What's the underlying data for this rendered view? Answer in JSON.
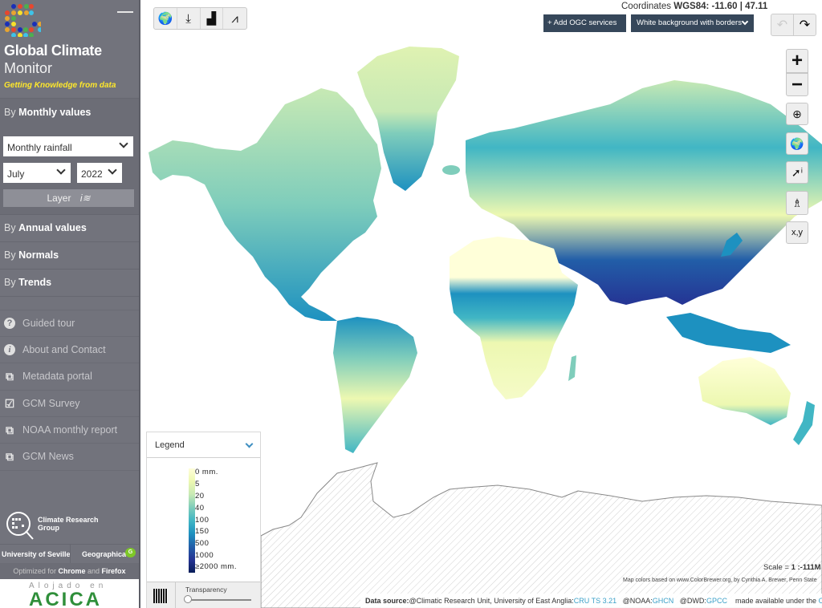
{
  "sidebar": {
    "brand": {
      "title": "Global Climate",
      "subtitle": "Monitor",
      "tagline": "Getting Knowledge from data"
    },
    "monthly": {
      "prefix": "By",
      "label": "Monthly values",
      "variable": "Monthly rainfall",
      "month": "July",
      "year": "2022",
      "layer_button": "Layer"
    },
    "sections": [
      {
        "prefix": "By",
        "label": "Annual values"
      },
      {
        "prefix": "By",
        "label": "Normals"
      },
      {
        "prefix": "By",
        "label": "Trends"
      }
    ],
    "links": [
      {
        "icon": "question-circle-icon",
        "glyph": "?",
        "label": "Guided tour"
      },
      {
        "icon": "info-circle-icon",
        "glyph": "i",
        "label": "About and Contact"
      },
      {
        "icon": "external-link-icon",
        "glyph": "⧉",
        "label": "Metadata portal"
      },
      {
        "icon": "checklist-icon",
        "glyph": "☑",
        "label": "GCM Survey"
      },
      {
        "icon": "external-link-icon",
        "glyph": "⧉",
        "label": "NOAA monthly report"
      },
      {
        "icon": "external-link-icon",
        "glyph": "⧉",
        "label": "GCM News"
      }
    ],
    "crg": {
      "line1": "Climate Research",
      "line2": "Group"
    },
    "university": "University of Seville",
    "geographica": "Geographica",
    "geographica_badge": "G",
    "optimized": {
      "prefix": "Optimized for",
      "b1": "Chrome",
      "and": "and",
      "b2": "Firefox"
    },
    "hosted": {
      "top": "Alojado en",
      "name": "ACICA"
    }
  },
  "toolbar": {
    "tools": [
      {
        "icon": "globe-icon",
        "glyph": "🌍"
      },
      {
        "icon": "download-icon",
        "glyph": "⤓"
      },
      {
        "icon": "bar-chart-icon",
        "glyph": "▟"
      },
      {
        "icon": "time-series-icon",
        "glyph": "⩘"
      }
    ]
  },
  "coordinates": {
    "label": "Coordinates",
    "system": "WGS84:",
    "lon": "-11.60",
    "lat": "47.11"
  },
  "ogc_button": "+ Add OGC services",
  "basemap": {
    "selected": "White background with borders"
  },
  "history": {
    "undo": "↶",
    "redo": "↷"
  },
  "map_controls": [
    {
      "name": "zoom-in-button",
      "glyph": "+"
    },
    {
      "name": "zoom-out-button",
      "glyph": "−"
    },
    {
      "name": "zoom-box-button",
      "glyph": "⊕"
    },
    {
      "name": "full-extent-button",
      "glyph": "🌍"
    },
    {
      "name": "identify-button",
      "glyph": "➚ⁱ"
    },
    {
      "name": "station-button",
      "glyph": "♗"
    },
    {
      "name": "xy-button",
      "glyph": "x,y"
    }
  ],
  "legend": {
    "title": "Legend",
    "units": "mm",
    "classes": [
      "0 mm.",
      "5",
      "20",
      "40",
      "100",
      "150",
      "500",
      "1000",
      "≥2000 mm."
    ],
    "colors": [
      "#ffffd9",
      "#edf8b1",
      "#c7e9b4",
      "#7fcdbb",
      "#41b6c4",
      "#1d91c0",
      "#225ea8",
      "#253494",
      "#081d58"
    ],
    "transparency_label": "Transparency",
    "transparency_value": 0
  },
  "scale": {
    "label": "Scale =",
    "value": "1 :-111M"
  },
  "attribution": "Map colors based on www.ColorBrewer.org, by Cynthia A. Brewer, Penn State",
  "data_source": {
    "prefix": "Data source:",
    "cru": "@Climatic Research Unit, University of East Anglia:",
    "cru_link": "CRU TS 3.21",
    "noaa": "@NOAA:",
    "noaa_link": "GHCN",
    "dwd": "@DWD:",
    "dwd_link": "GPCC",
    "license": "made available under the",
    "license_link": "ODL"
  }
}
